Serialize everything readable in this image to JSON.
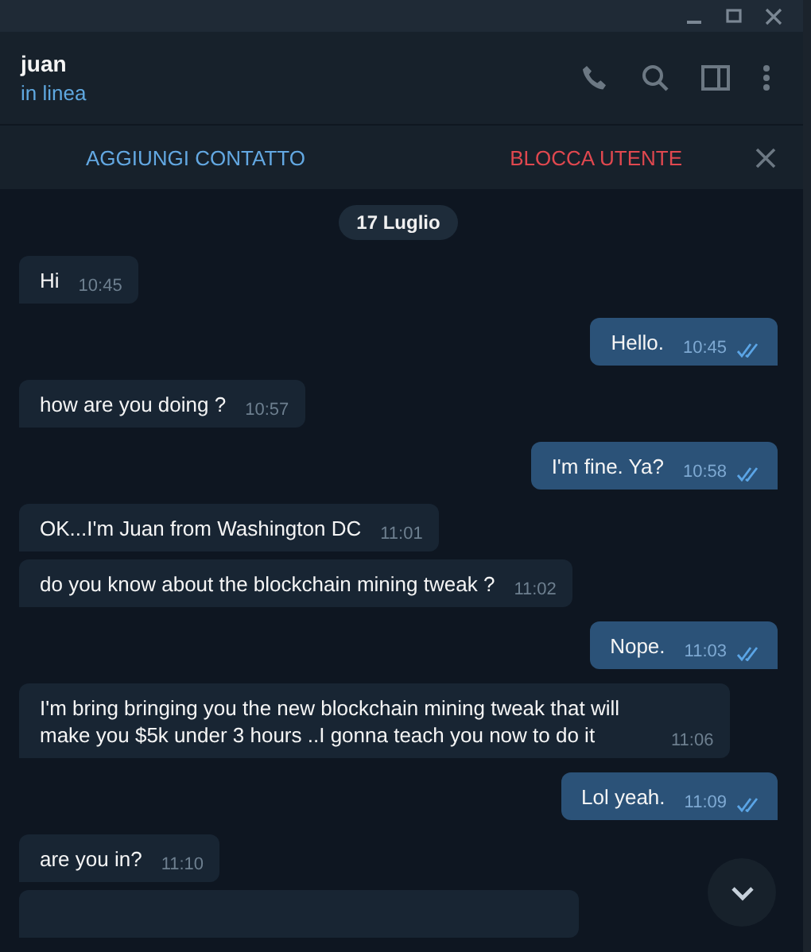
{
  "header": {
    "name": "juan",
    "status": "in linea"
  },
  "action_bar": {
    "add_contact": "AGGIUNGI CONTATTO",
    "block_user": "BLOCCA UTENTE"
  },
  "date_badge": "17 Luglio",
  "messages": [
    {
      "kind": "incoming",
      "text": "Hi",
      "time": "10:45"
    },
    {
      "kind": "outgoing",
      "text": "Hello.",
      "time": "10:45",
      "read": true
    },
    {
      "kind": "incoming",
      "text": "how are you doing ?",
      "time": "10:57"
    },
    {
      "kind": "outgoing",
      "text": "I'm fine. Ya?",
      "time": "10:58",
      "read": true
    },
    {
      "kind": "incoming",
      "text": "OK...I'm Juan from Washington DC",
      "time": "11:01"
    },
    {
      "kind": "incoming",
      "text": "do you know about the blockchain mining tweak ?",
      "time": "11:02"
    },
    {
      "kind": "outgoing",
      "text": "Nope.",
      "time": "11:03",
      "read": true
    },
    {
      "kind": "incoming",
      "text": "I'm bring bringing you the new blockchain mining tweak that will make you $5k under 3 hours ..I gonna teach you now to do it",
      "time": "11:06"
    },
    {
      "kind": "outgoing",
      "text": "Lol yeah.",
      "time": "11:09",
      "read": true
    },
    {
      "kind": "incoming",
      "text": "are you in?",
      "time": "11:10"
    },
    {
      "kind": "cut"
    }
  ]
}
